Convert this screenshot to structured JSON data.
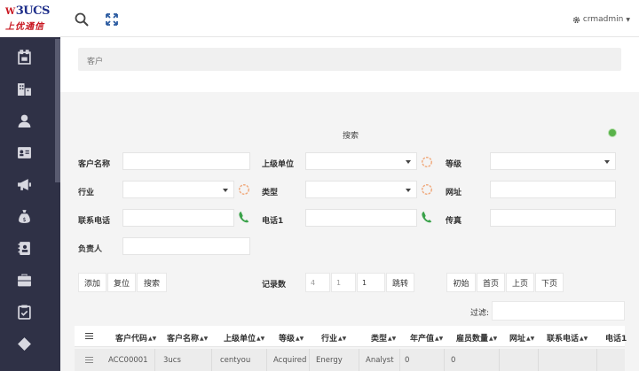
{
  "logo": {
    "mark": "3UCS",
    "tagline": "上优通信"
  },
  "header": {
    "user": "crmadmin"
  },
  "breadcrumb": {
    "current": "客户"
  },
  "search_panel": {
    "title": "搜索",
    "fields": {
      "customer_name": "客户名称",
      "parent_unit": "上级单位",
      "level": "等级",
      "industry": "行业",
      "type": "类型",
      "website": "网址",
      "phone": "联系电话",
      "phone1": "电话1",
      "fax": "传真",
      "owner": "负责人"
    }
  },
  "toolbar": {
    "add": "添加",
    "reset": "复位",
    "search": "搜索",
    "record_count_label": "记录数",
    "record_count": "4",
    "total_pages": "1",
    "page_input": "1",
    "jump": "跳转",
    "first": "初始",
    "home": "首页",
    "prev": "上页",
    "next": "下页"
  },
  "filter": {
    "label": "过滤:"
  },
  "table": {
    "columns": [
      "客户代码",
      "客户名称",
      "上级单位",
      "等级",
      "行业",
      "类型",
      "年产值",
      "雇员数量",
      "网址",
      "联系电话",
      "电话1"
    ],
    "rows": [
      [
        "ACC00001",
        "3ucs",
        "centyou",
        "Acquired",
        "Energy",
        "Analyst",
        "0",
        "0",
        "",
        "",
        ""
      ]
    ]
  },
  "colors": {
    "sidebar": "#2f3146",
    "status": "#59b24a"
  }
}
